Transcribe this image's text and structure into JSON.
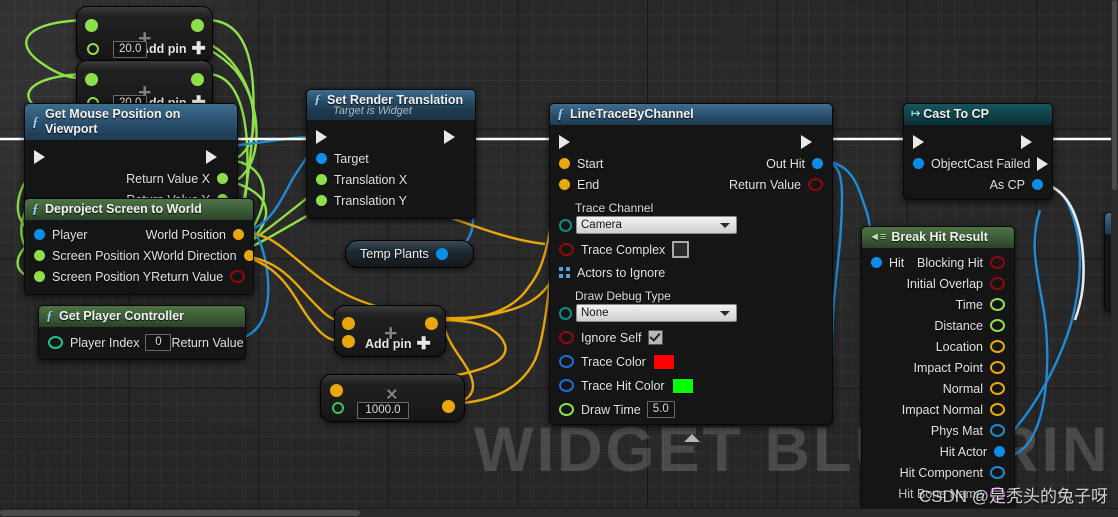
{
  "app": {
    "type": "unreal-blueprint-graph",
    "watermark": "WIDGET BLUEPRINT",
    "attribution": "CSDN @是秃头的兔子呀"
  },
  "colors": {
    "exec_white": "#ffffff",
    "float_green": "#8ee04a",
    "object_blue": "#0a8ee8",
    "vector_gold": "#e8a80a",
    "bool_red": "#8c0a0a",
    "struct_teal": "#0e8c8c",
    "name_purple": "#c44ad4",
    "header_function": "#2a4f6b",
    "header_pure": "#3b5c36",
    "header_cast": "#0f4148",
    "trace_color": "#ff0000",
    "trace_hit_color": "#00ff00"
  },
  "nodes": {
    "multiply_a": {
      "title": "",
      "op": "+",
      "add_pin_label": "Add pin",
      "value": "20.0"
    },
    "multiply_b": {
      "title": "",
      "op": "+",
      "add_pin_label": "Add pin",
      "value": "20.0"
    },
    "get_mouse_position": {
      "title": "Get Mouse Position on Viewport",
      "icon": "function-f-icon",
      "outputs": [
        "Return Value X",
        "Return Value Y"
      ]
    },
    "deproject": {
      "title": "Deproject Screen to World",
      "icon": "function-f-icon",
      "inputs": [
        "Player",
        "Screen Position X",
        "Screen Position Y"
      ],
      "outputs": [
        "World Position",
        "World Direction",
        "Return Value"
      ]
    },
    "get_player_controller": {
      "title": "Get Player Controller",
      "icon": "function-f-icon",
      "input_label": "Player Index",
      "input_value": "0",
      "output_label": "Return Value"
    },
    "set_render_translation": {
      "title": "Set Render Translation",
      "subtitle": "Target is Widget",
      "icon": "function-f-icon",
      "inputs": [
        "Target",
        "Translation X",
        "Translation Y"
      ]
    },
    "temp_plants": {
      "title": "Temp Plants"
    },
    "add_node": {
      "op": "+",
      "add_pin_label": "Add pin"
    },
    "mult_node": {
      "op": "×",
      "value": "1000.0"
    },
    "line_trace": {
      "title": "LineTraceByChannel",
      "icon": "function-f-icon",
      "inputs": [
        {
          "label": "Start",
          "type": "vector"
        },
        {
          "label": "End",
          "type": "vector"
        }
      ],
      "trace_channel_label": "Trace Channel",
      "trace_channel_value": "Camera",
      "trace_complex_label": "Trace Complex",
      "trace_complex_checked": false,
      "actors_to_ignore_label": "Actors to Ignore",
      "draw_debug_type_label": "Draw Debug Type",
      "draw_debug_type_value": "None",
      "ignore_self_label": "Ignore Self",
      "ignore_self_checked": true,
      "trace_color_label": "Trace Color",
      "trace_hit_color_label": "Trace Hit Color",
      "draw_time_label": "Draw Time",
      "draw_time_value": "5.0",
      "outputs": [
        "Out Hit",
        "Return Value"
      ]
    },
    "cast_to_cp": {
      "title": "Cast To CP",
      "icon": "cast-icon",
      "input_label": "Object",
      "outputs": [
        "Cast Failed",
        "As CP"
      ]
    },
    "break_hit_result": {
      "title": "Break Hit Result",
      "icon": "break-struct-icon",
      "input_label": "Hit",
      "outputs": [
        {
          "label": "Blocking Hit",
          "type": "bool"
        },
        {
          "label": "Initial Overlap",
          "type": "bool"
        },
        {
          "label": "Time",
          "type": "float"
        },
        {
          "label": "Distance",
          "type": "float"
        },
        {
          "label": "Location",
          "type": "vector"
        },
        {
          "label": "Impact Point",
          "type": "vector"
        },
        {
          "label": "Normal",
          "type": "vector"
        },
        {
          "label": "Impact Normal",
          "type": "vector"
        },
        {
          "label": "Phys Mat",
          "type": "object"
        },
        {
          "label": "Hit Actor",
          "type": "object"
        },
        {
          "label": "Hit Component",
          "type": "object"
        },
        {
          "label": "Hit Bone Name",
          "type": "name"
        }
      ]
    }
  }
}
